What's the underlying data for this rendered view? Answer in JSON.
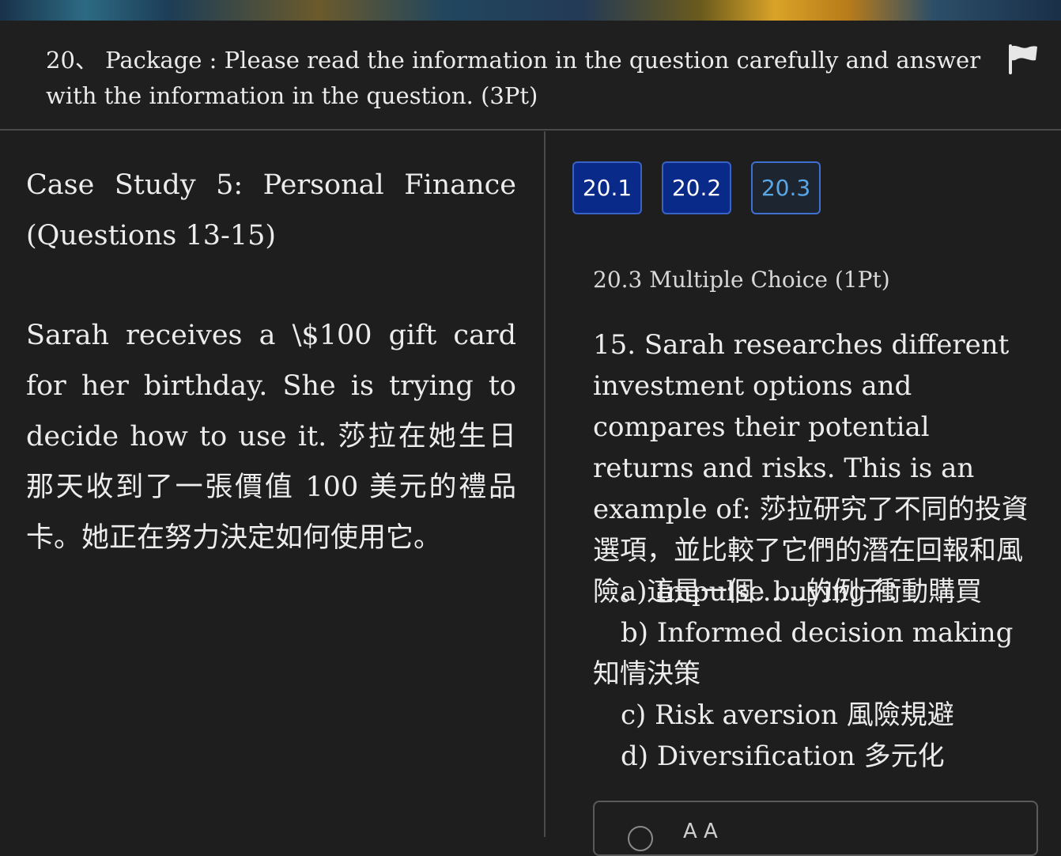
{
  "header": {
    "question_title": "20、 Package : Please read the information in the question carefully and answer with the information in the question. (3Pt)",
    "flag_icon": "flag-icon"
  },
  "case": {
    "title": "Case Study 5: Personal Finance",
    "subtitle": "(Questions 13-15)",
    "body": "Sarah receives a \\$100 gift card for her birthday.  She is trying to decide how to use it. 莎拉在她生日那天收到了一張價值 100 美元的禮品卡。她正在努力決定如何使用它。"
  },
  "tabs": [
    {
      "label": "20.1"
    },
    {
      "label": "20.2"
    },
    {
      "label": "20.3"
    }
  ],
  "sub_question": {
    "label": "20.3 Multiple Choice (1Pt)",
    "text": "15. Sarah researches different investment options and compares their potential returns and risks. This is an example of: 莎拉研究了不同的投資選項，並比較了它們的潛在回報和風險。這是一個......的例子：",
    "options": [
      "a) Impulse buying 衝動購買",
      "b) Informed decision making 知情決策",
      "c) Risk aversion 風險規避",
      "d) Diversification 多元化"
    ],
    "answer_hint": "A A"
  },
  "colors": {
    "background": "#1e1e1e",
    "tab_filled": "#0a2a8a",
    "tab_active_text": "#5aa7e8",
    "tab_border": "#3a62c4"
  }
}
